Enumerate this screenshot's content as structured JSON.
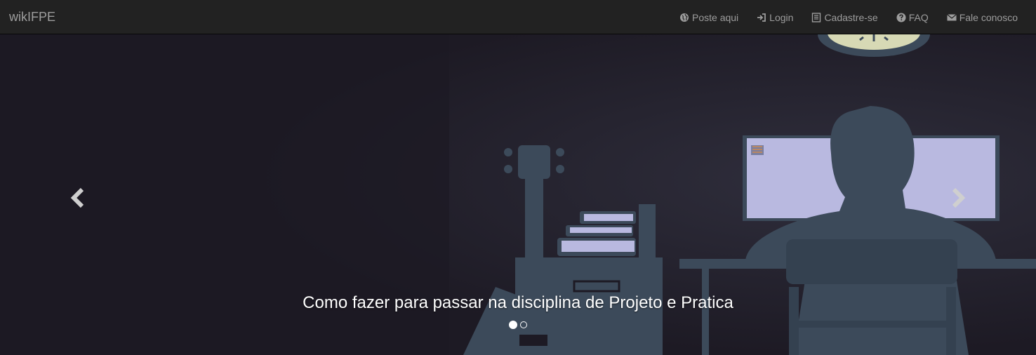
{
  "navbar": {
    "brand": "wikIFPE",
    "items": [
      {
        "label": "Poste aqui",
        "icon": "globe-icon"
      },
      {
        "label": "Login",
        "icon": "log-in-icon"
      },
      {
        "label": "Cadastre-se",
        "icon": "list-alt-icon"
      },
      {
        "label": "FAQ",
        "icon": "question-sign-icon"
      },
      {
        "label": "Fale conosco",
        "icon": "envelope-icon"
      }
    ]
  },
  "carousel": {
    "caption": "Como fazer para passar na disciplina de Projeto e Pratica",
    "slide_count": 2,
    "active_index": 0,
    "prev_icon": "chevron-left-icon",
    "next_icon": "chevron-right-icon"
  },
  "colors": {
    "navbar_bg": "#222222",
    "nav_text": "#9d9d9d",
    "slide_bg": "#1d1a24",
    "silhouette": "#3c4a5a",
    "screen": "#b9b9e0"
  }
}
